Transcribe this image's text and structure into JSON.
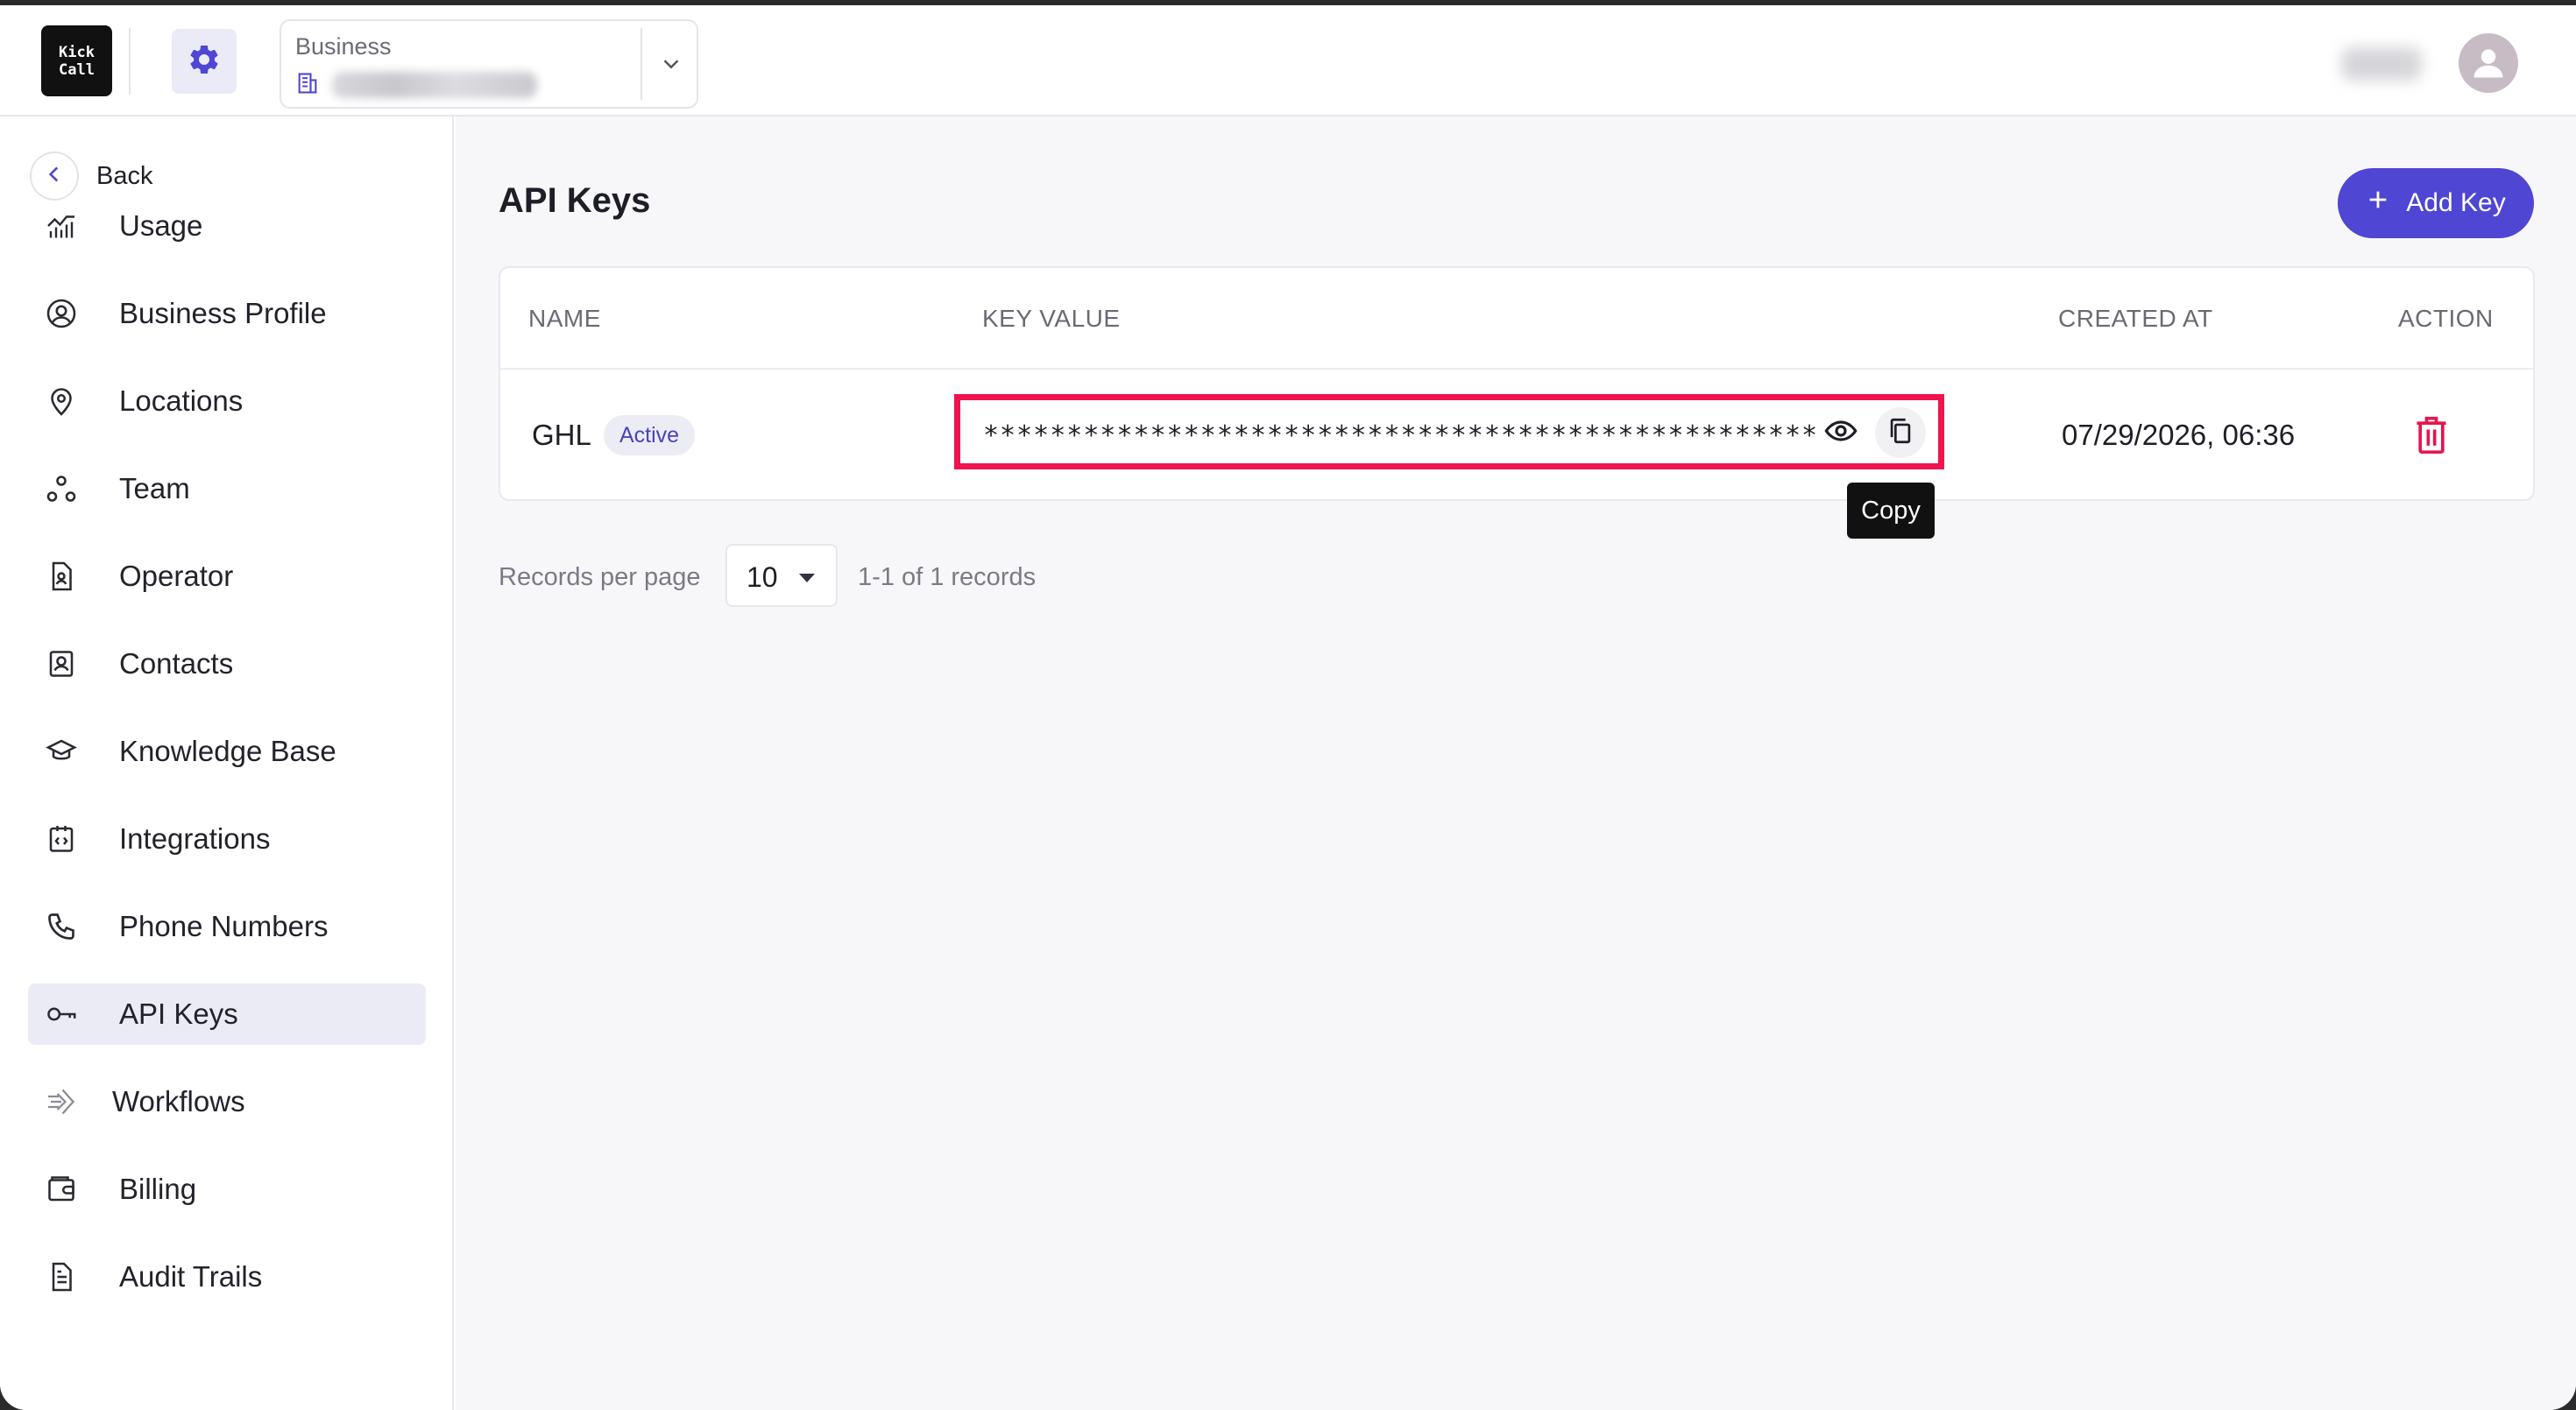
{
  "header": {
    "logo_line1": "Kick",
    "logo_line2": "Call",
    "business_label": "Business"
  },
  "sidebar": {
    "back_label": "Back",
    "items": [
      {
        "label": "Usage",
        "icon": "chart-line-icon"
      },
      {
        "label": "Business Profile",
        "icon": "user-circle-icon"
      },
      {
        "label": "Locations",
        "icon": "location-pin-icon"
      },
      {
        "label": "Team",
        "icon": "team-nodes-icon"
      },
      {
        "label": "Operator",
        "icon": "operator-badge-icon"
      },
      {
        "label": "Contacts",
        "icon": "contact-card-icon"
      },
      {
        "label": "Knowledge Base",
        "icon": "graduation-cap-icon"
      },
      {
        "label": "Integrations",
        "icon": "code-calendar-icon"
      },
      {
        "label": "Phone Numbers",
        "icon": "phone-icon"
      },
      {
        "label": "API Keys",
        "icon": "key-icon",
        "active": true
      },
      {
        "label": "Workflows",
        "icon": "workflow-icon"
      },
      {
        "label": "Billing",
        "icon": "wallet-icon"
      },
      {
        "label": "Audit Trails",
        "icon": "document-icon"
      }
    ]
  },
  "main": {
    "title": "API Keys",
    "add_button_label": "Add Key",
    "table": {
      "headers": [
        "NAME",
        "KEY VALUE",
        "CREATED AT",
        "ACTION"
      ],
      "rows": [
        {
          "name": "GHL",
          "status": "Active",
          "key_value": "**************************************************",
          "created_at": "07/29/2026, 06:36"
        }
      ]
    },
    "tooltip": "Copy",
    "pagination": {
      "per_page_label": "Records per page",
      "per_page_value": "10",
      "records_text": "1-1 of 1 records"
    }
  },
  "colors": {
    "accent": "#4f46d4",
    "highlight_border": "#f0134e",
    "delete": "#e3174f",
    "active_nav_bg": "#ebebf5"
  }
}
